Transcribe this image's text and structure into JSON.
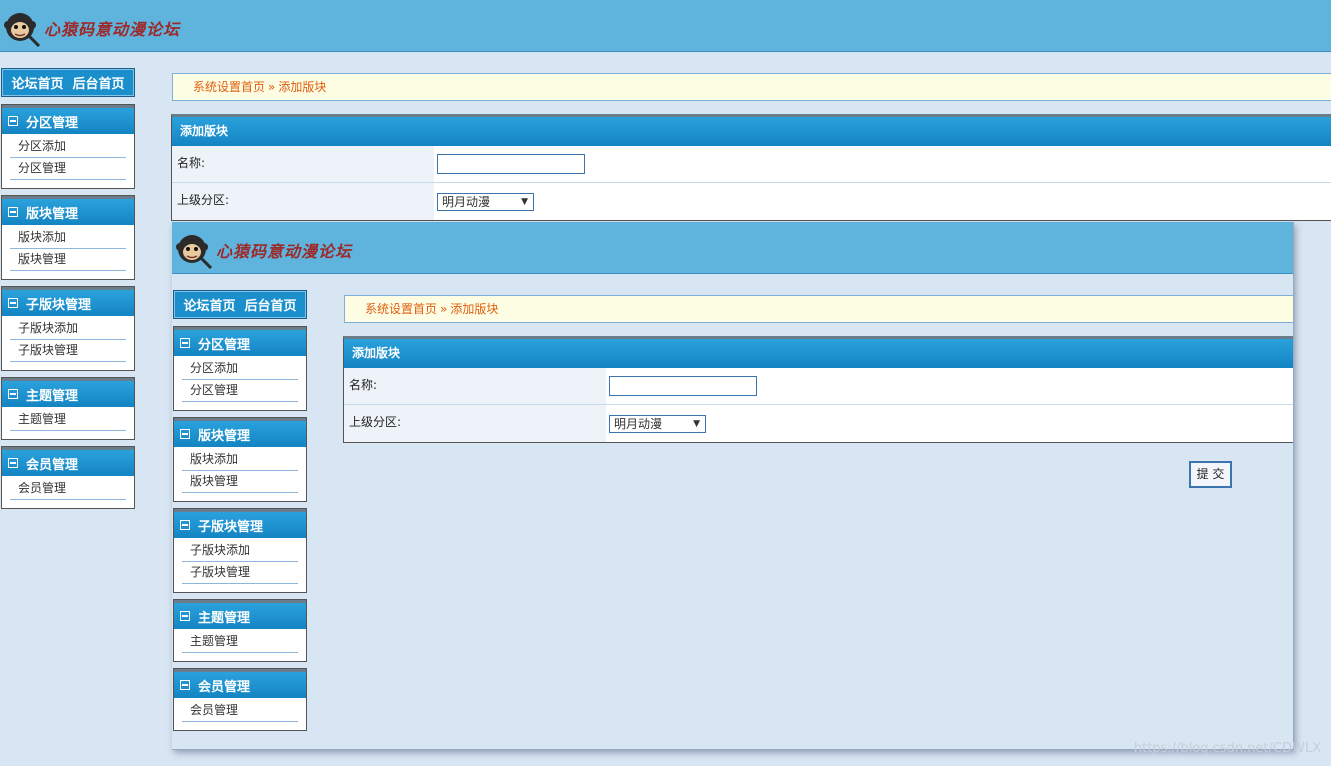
{
  "site": {
    "logo_text": "心猿码意动漫论坛",
    "top_links": [
      "论坛首页",
      "后台首页"
    ]
  },
  "sidebar": {
    "groups": [
      {
        "title": "分区管理",
        "items": [
          "分区添加",
          "分区管理"
        ]
      },
      {
        "title": "版块管理",
        "items": [
          "版块添加",
          "版块管理"
        ]
      },
      {
        "title": "子版块管理",
        "items": [
          "子版块添加",
          "子版块管理"
        ]
      },
      {
        "title": "主题管理",
        "items": [
          "主题管理"
        ]
      },
      {
        "title": "会员管理",
        "items": [
          "会员管理"
        ]
      }
    ]
  },
  "breadcrumb": {
    "home": "系统设置首页",
    "separator": "»",
    "current": "添加版块"
  },
  "form": {
    "title": "添加版块",
    "name_label": "名称:",
    "name_value": "",
    "parent_label": "上级分区:",
    "parent_selected": "明月动漫",
    "submit_label": "提 交"
  },
  "watermark": "https://blog.csdn.net/CDWLX",
  "colors": {
    "header_bg": "#5fb4dd",
    "panel_head": "#1a8fcb",
    "page_bg": "#d8e5f3",
    "breadcrumb_text": "#e05e10"
  }
}
